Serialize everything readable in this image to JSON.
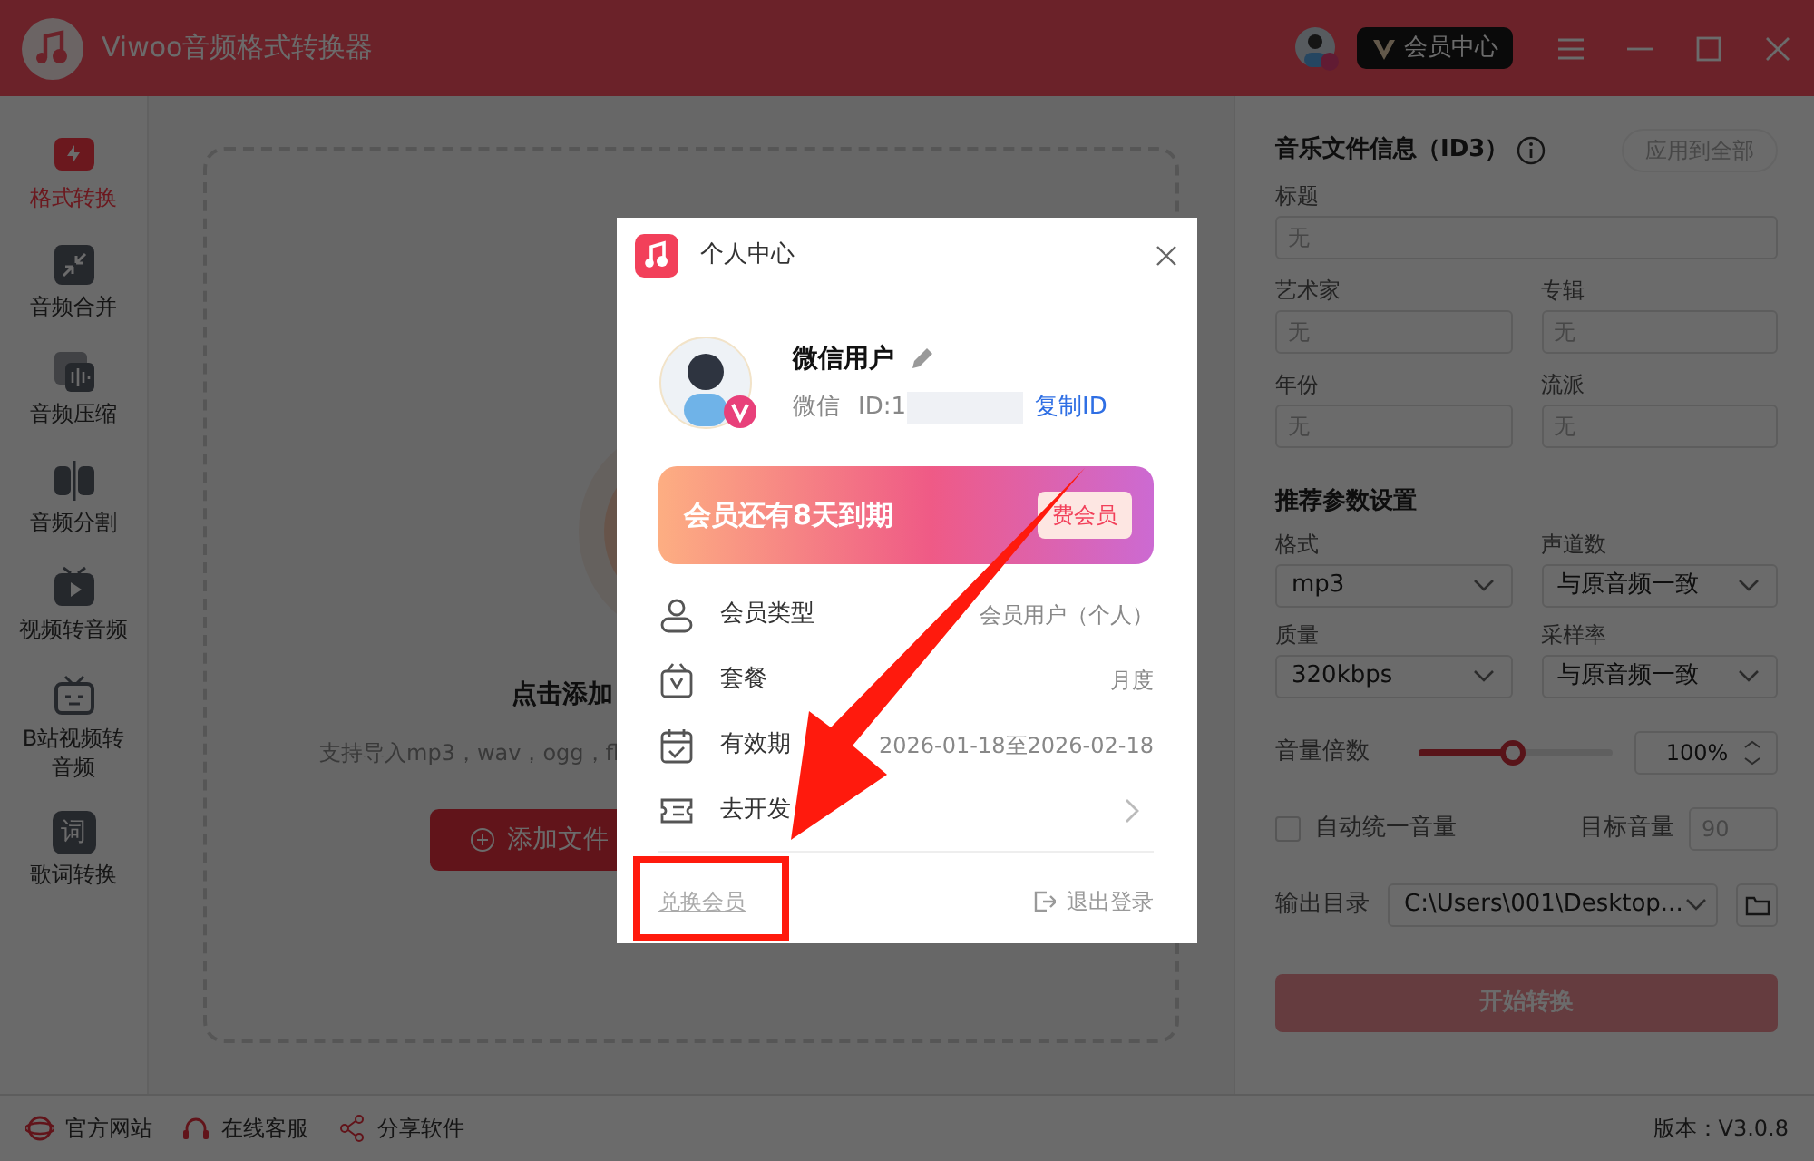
{
  "app": {
    "title": "Viwoo音频格式转换器",
    "vip_label": "会员中心"
  },
  "sidebar": {
    "items": [
      {
        "kind": "convert",
        "label": "格式转换",
        "selected": true
      },
      {
        "kind": "merge",
        "label": "音频合并",
        "selected": false
      },
      {
        "kind": "compress",
        "label": "音频压缩",
        "selected": false
      },
      {
        "kind": "split",
        "label": "音频分割",
        "selected": false
      },
      {
        "kind": "video",
        "label": "视频转音频",
        "selected": false
      },
      {
        "kind": "tv",
        "label": "B站视频转音频",
        "selected": false
      },
      {
        "kind": "lyrics",
        "label": "歌词转换",
        "selected": false,
        "icon_text": "词"
      }
    ]
  },
  "drop_zone": {
    "heading": "点击添加",
    "hint": "支持导入mp3，wav，ogg，fl",
    "button": "添加文件"
  },
  "id3": {
    "title": "音乐文件信息（ID3）",
    "apply_all": "应用到全部",
    "fields": [
      {
        "label": "标题",
        "placeholder": "无"
      },
      {
        "label": "艺术家",
        "placeholder": "无"
      },
      {
        "label": "专辑",
        "placeholder": "无"
      },
      {
        "label": "年份",
        "placeholder": "无"
      },
      {
        "label": "流派",
        "placeholder": "无"
      }
    ]
  },
  "params": {
    "title": "推荐参数设置",
    "selects": [
      {
        "label": "格式",
        "value": "mp3"
      },
      {
        "label": "声道数",
        "value": "与原音频一致"
      },
      {
        "label": "质量",
        "value": "320kbps"
      },
      {
        "label": "采样率",
        "value": "与原音频一致"
      }
    ],
    "volume": {
      "label": "音量倍数",
      "level": 0.49,
      "value": "100%"
    },
    "normalize": {
      "label": "自动统一音量",
      "checked": false,
      "target_label": "目标音量",
      "target_placeholder": "90"
    },
    "output": {
      "label": "输出目录",
      "value": "C:\\Users\\001\\Desktop..."
    },
    "start": {
      "label": "开始转换",
      "disabled": true
    }
  },
  "footer": {
    "links": [
      "官方网站",
      "在线客服",
      "分享软件"
    ],
    "version": "版本：V3.0.8"
  },
  "dialog": {
    "title": "个人中心",
    "user": {
      "name": "微信用户",
      "source": "微信",
      "id": "ID:1",
      "copy": "复制ID"
    },
    "banner": {
      "text": "会员还有8天到期",
      "button": "费会员"
    },
    "rows": [
      {
        "kind": "type",
        "label": "会员类型",
        "value": "会员用户（个人）"
      },
      {
        "kind": "plan",
        "label": "套餐",
        "value": "月度"
      },
      {
        "kind": "period",
        "label": "有效期",
        "value": "2026-01-18至2026-02-18"
      },
      {
        "kind": "invoice",
        "label": "去开发"
      }
    ],
    "redeem": "兑换会员",
    "logout": "退出登录"
  },
  "annotation": {
    "arrow": true,
    "highlight_frame": true
  }
}
